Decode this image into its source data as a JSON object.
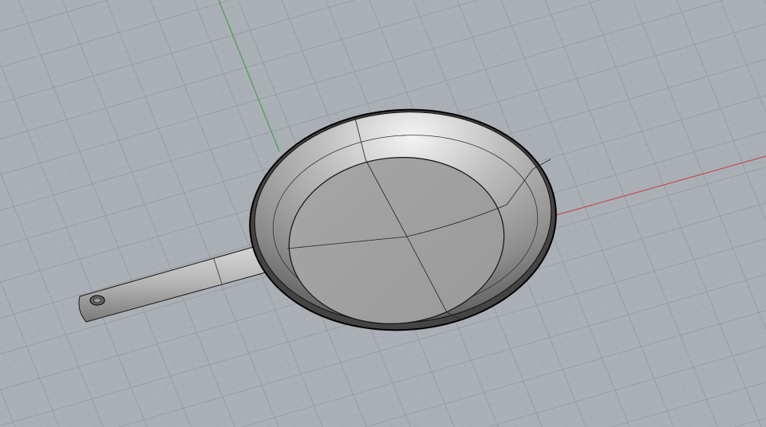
{
  "viewport": {
    "view": "perspective",
    "display_mode": "shaded",
    "object": "frying-pan"
  },
  "colors": {
    "background": "#abb0b7",
    "grid_minor": "#a2a8b0",
    "grid_major": "#959ba4",
    "x_axis": "#c0504d",
    "y_axis": "#4f9a52",
    "edge": "#1a1a1a"
  }
}
